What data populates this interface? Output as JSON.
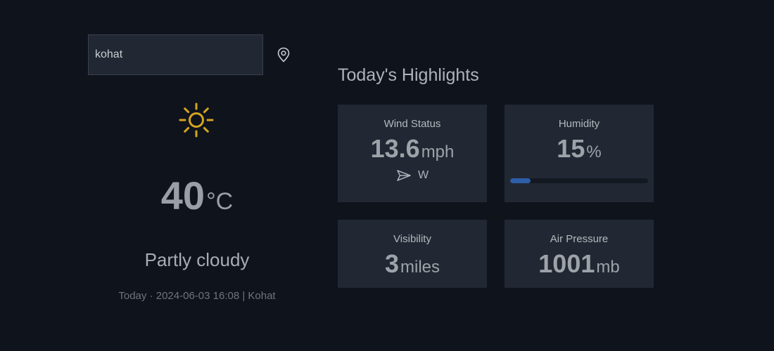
{
  "search": {
    "value": "kohat"
  },
  "current": {
    "icon": "sun-icon",
    "temperature": "40",
    "unit": "°C",
    "condition": "Partly cloudy",
    "date_line": "Today · 2024-06-03 16:08 | Kohat"
  },
  "highlights": {
    "title": "Today's Highlights",
    "wind": {
      "label": "Wind Status",
      "value": "13.6",
      "unit": "mph",
      "direction": "W"
    },
    "humidity": {
      "label": "Humidity",
      "value": "15",
      "unit": "%",
      "percent": 15
    },
    "visibility": {
      "label": "Visibility",
      "value": "3",
      "unit": "miles"
    },
    "pressure": {
      "label": "Air Pressure",
      "value": "1001",
      "unit": "mb"
    }
  },
  "colors": {
    "accent": "#d4a520",
    "progress": "#2e5ea8",
    "card": "#222833",
    "background": "#0f131c"
  }
}
